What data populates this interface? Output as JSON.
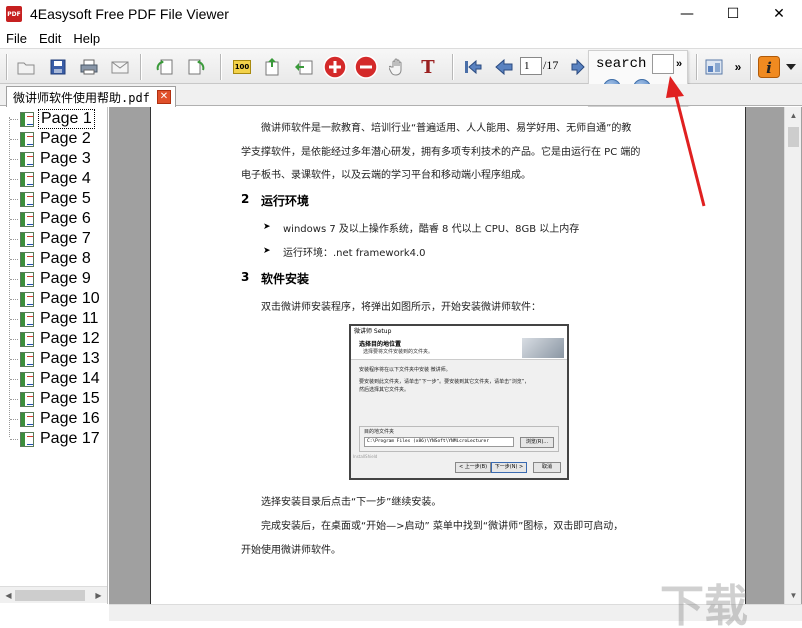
{
  "window": {
    "title": "4Easysoft Free PDF File Viewer",
    "app_icon_text": "PDF",
    "minimize_glyph": "—",
    "maximize_glyph": "☐",
    "close_glyph": "✕"
  },
  "menu": {
    "items": [
      "File",
      "Edit",
      "Help"
    ]
  },
  "toolbar": {
    "zoom_badge": "100",
    "text_tool_glyph": "T",
    "current_page": "1",
    "total_pages": "/17",
    "overflow_glyph": "»"
  },
  "search": {
    "label": "search",
    "value": "",
    "more_glyph": "»"
  },
  "tab": {
    "label": "微讲师软件使用帮助.pdf",
    "close_glyph": "✕"
  },
  "sidebar": {
    "pages": [
      "Page 1",
      "Page 2",
      "Page 3",
      "Page 4",
      "Page 5",
      "Page 6",
      "Page 7",
      "Page 8",
      "Page 9",
      "Page 10",
      "Page 11",
      "Page 12",
      "Page 13",
      "Page 14",
      "Page 15",
      "Page 16",
      "Page 17"
    ],
    "selected": "Page 1"
  },
  "document": {
    "intro_line1": "微讲师软件是一款教育、培训行业“普遍适用、人人能用、易学好用、无师自通”的教",
    "intro_line2": "学支撑软件，是依能经过多年潜心研发，拥有多项专利技术的产品。它是由运行在 PC 端的",
    "intro_line3": "电子板书、录课软件，以及云端的学习平台和移动端小程序组成。",
    "section2_num": "2",
    "section2_title": "运行环境",
    "bullet1": "windows 7 及以上操作系统，酷睿 8 代以上 CPU、8GB 以上内存",
    "bullet2": "运行环境：.net framework4.0",
    "section3_num": "3",
    "section3_title": "软件安装",
    "install_text": "双击微讲师安装程序，将弹出如图所示，开始安装微讲师软件：",
    "after_line1": "选择安装目录后点击“下一步”继续安装。",
    "after_line2": "完成安装后，在桌面或“开始—>启动” 菜单中找到“微讲师”图标，双击即可启动，",
    "after_line3": "开始使用微讲师软件。",
    "bullet_glyph": "➤"
  },
  "installer": {
    "title": "微讲师 Setup",
    "heading": "选择目的地位置",
    "subheading": "选择要将文件安装到的文件夹。",
    "line1": "安装程序将在以下文件夹中安装 微讲师。",
    "line2": "要安装到此文件夹，请单击“下一步”。要安装到其它文件夹，请单击“浏览”，",
    "line3": "然后选择其它文件夹。",
    "group_label": "目的地文件夹",
    "path": "C:\\Program Files (x86)\\YNSoft\\YNMicroLecturer",
    "browse": "浏览(R)...",
    "footer": "InstallShield",
    "back": "< 上一步(B)",
    "next": "下一步(N) >",
    "cancel": "取消"
  },
  "watermark": {
    "text": "下载吧"
  },
  "colors": {
    "annotation_arrow": "#e02020",
    "tab_close": "#e0502a",
    "add_button": "#d42a2a"
  }
}
